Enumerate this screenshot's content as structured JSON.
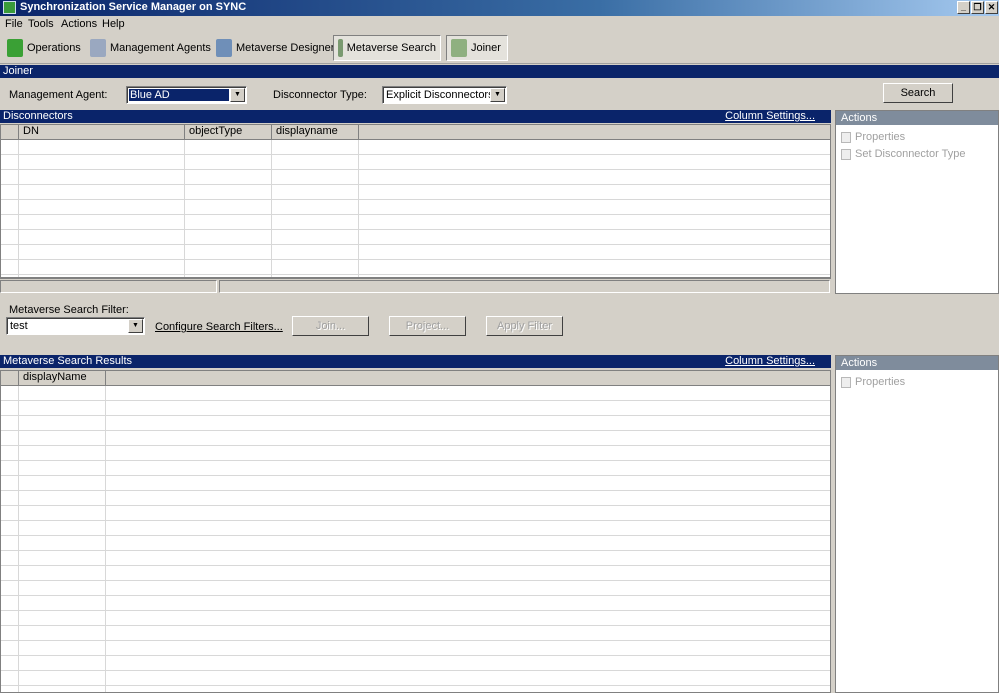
{
  "window": {
    "title": "Synchronization Service Manager on SYNC"
  },
  "menu": [
    "File",
    "Tools",
    "Actions",
    "Help"
  ],
  "toolbar": {
    "operations": "Operations",
    "management_agents": "Management Agents",
    "metaverse_designer": "Metaverse Designer",
    "metaverse_search": "Metaverse Search",
    "joiner": "Joiner"
  },
  "joiner": {
    "header": "Joiner",
    "management_agent_label": "Management Agent:",
    "management_agent_value": "Blue AD",
    "disconnector_type_label": "Disconnector Type:",
    "disconnector_type_value": "Explicit Disconnectors",
    "search_button": "Search"
  },
  "disconnectors": {
    "header": "Disconnectors",
    "column_settings": "Column Settings...",
    "columns": [
      "DN",
      "objectType",
      "displayname"
    ]
  },
  "actions_top": {
    "header": "Actions",
    "items": [
      "Properties",
      "Set Disconnector Type"
    ]
  },
  "filter": {
    "label": "Metaverse Search Filter:",
    "value": "test",
    "configure_link": "Configure Search Filters...",
    "join_button": "Join...",
    "project_button": "Project...",
    "apply_filter_button": "Apply Filter"
  },
  "results": {
    "header": "Metaverse Search Results",
    "column_settings": "Column Settings...",
    "columns": [
      "displayName"
    ]
  },
  "actions_bottom": {
    "header": "Actions",
    "items": [
      "Properties"
    ]
  }
}
